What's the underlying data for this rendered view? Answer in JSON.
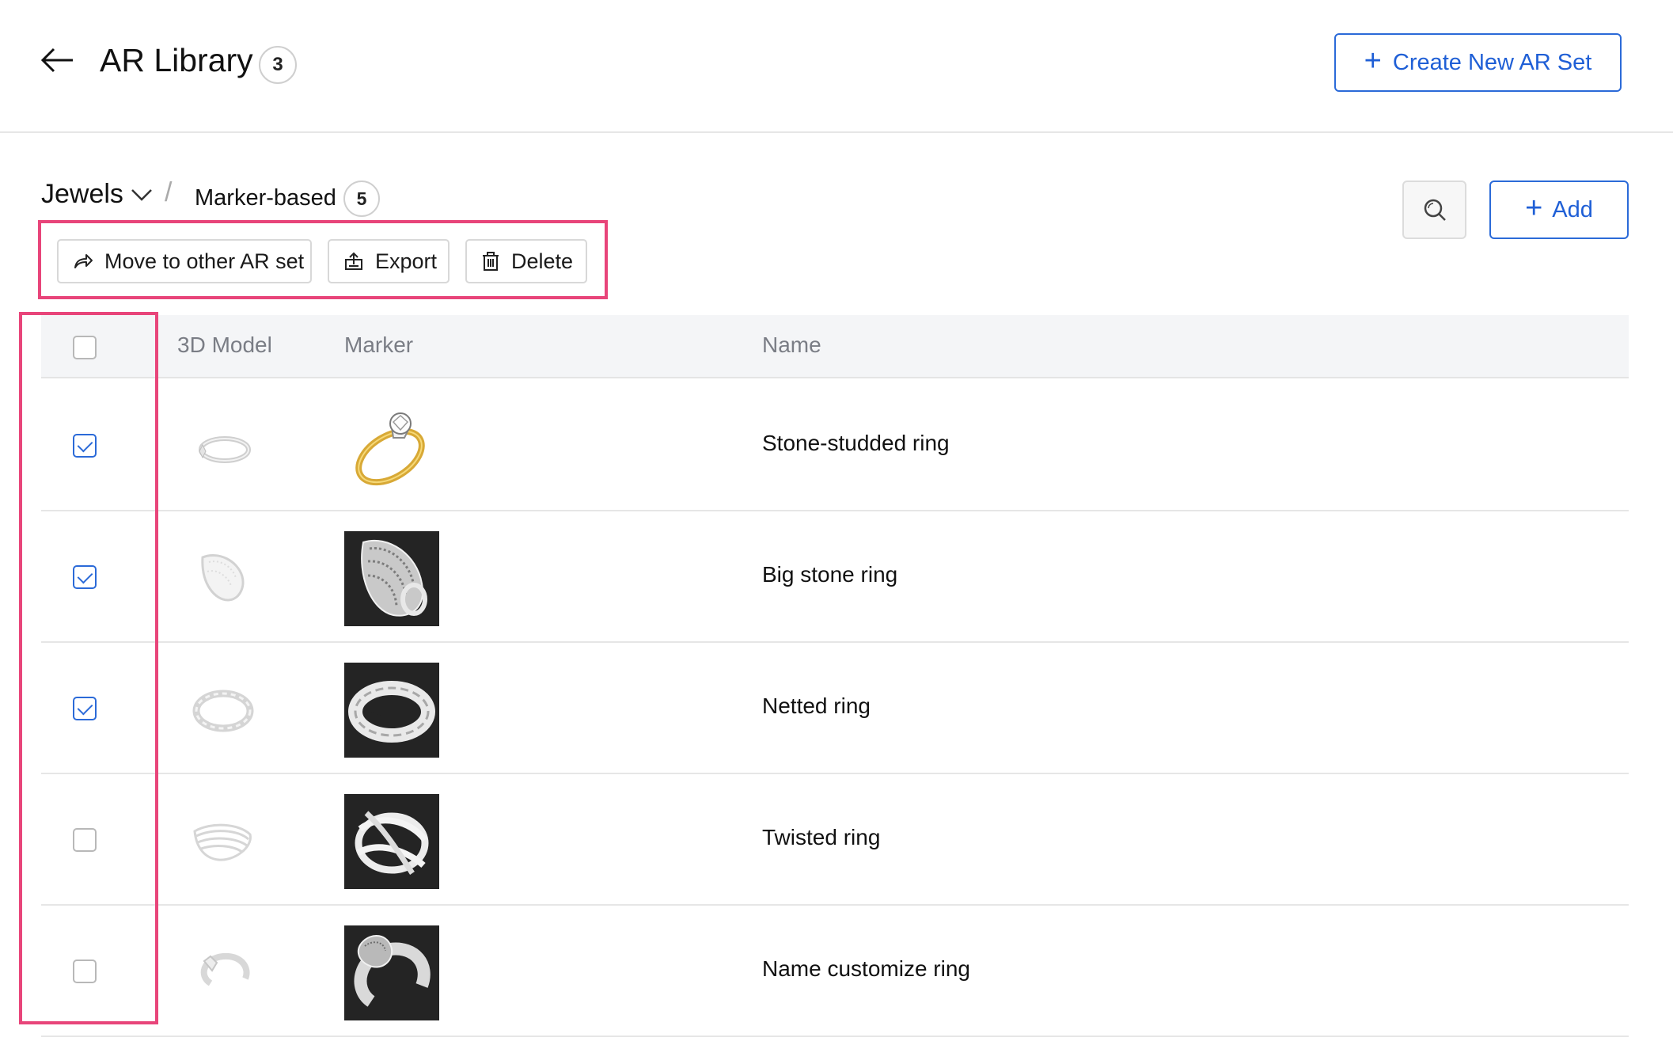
{
  "header": {
    "title": "AR Library",
    "title_count": "3",
    "create_button_label": "Create New AR Set",
    "back_icon": "arrow-left-icon"
  },
  "breadcrumb": {
    "parent": "Jewels",
    "separator": "/",
    "current": "Marker-based",
    "current_count": "5"
  },
  "toolbar": {
    "add_label": "Add",
    "search_icon": "search-icon"
  },
  "actions": {
    "move_label": "Move to other AR set",
    "export_label": "Export",
    "delete_label": "Delete"
  },
  "table": {
    "columns": [
      "3D Model",
      "Marker",
      "Name"
    ],
    "rows": [
      {
        "name": "Stone-studded ring",
        "checked": true,
        "marker": "solitaire-ring-gold"
      },
      {
        "name": "Big stone ring",
        "checked": true,
        "marker": "pave-ring"
      },
      {
        "name": "Netted ring",
        "checked": true,
        "marker": "braided-ring"
      },
      {
        "name": "Twisted ring",
        "checked": false,
        "marker": "twisted-ring"
      },
      {
        "name": "Name customize ring",
        "checked": false,
        "marker": "open-ring"
      }
    ]
  },
  "colors": {
    "accent": "#2b6ad8",
    "highlight": "#e8457a",
    "header_row_bg": "#f4f5f7",
    "marker_bg": "#242424"
  }
}
